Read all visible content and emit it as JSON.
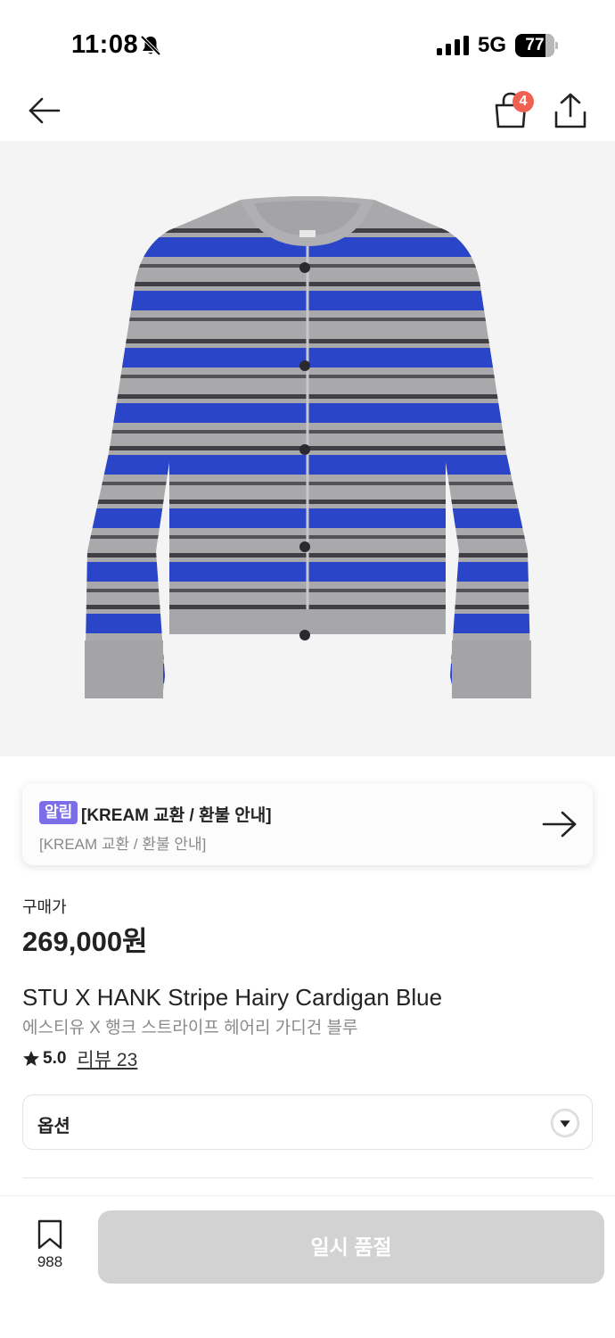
{
  "status_bar": {
    "time": "11:08",
    "network": "5G",
    "battery_level": "77",
    "battery_fraction": 0.77,
    "icons": [
      "bell-slash-icon",
      "signal-icon",
      "battery-icon"
    ]
  },
  "nav": {
    "icons": [
      "back-arrow-icon",
      "shopping-bag-icon",
      "share-icon"
    ],
    "bag_badge": "4"
  },
  "product_image": {
    "icon": "striped-cardigan-image",
    "colors": {
      "blue": "#2b45c9",
      "gray": "#a9a9ab",
      "dark": "#2d2d33",
      "background": "#f4f4f4"
    }
  },
  "notice": {
    "tag": "알림",
    "title": "[KREAM 교환 / 환불 안내]",
    "subtitle": "[KREAM 교환 / 환불 안내]",
    "icon": "arrow-right-icon",
    "tag_color": "#7b6ee8"
  },
  "price": {
    "label": "구매가",
    "value": "269,000원"
  },
  "product": {
    "name": "STU X HANK Stripe Hairy Cardigan Blue",
    "name_ko": "에스티유 X 행크 스트라이프 헤어리 가디건 블루",
    "rating": "5.0",
    "review_link": "리뷰 23"
  },
  "option": {
    "label": "옵션",
    "icon": "chevron-down-icon"
  },
  "bottom_bar": {
    "bookmark_count": "988",
    "action_label": "일시 품절",
    "action_color": "#d2d2d2"
  }
}
